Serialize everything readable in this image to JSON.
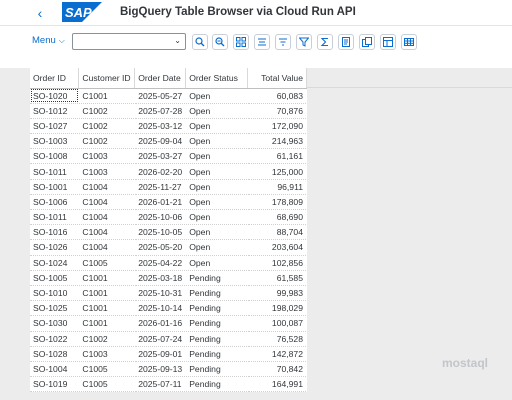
{
  "header": {
    "back_icon": "back-chevron-icon",
    "logo_text": "SAP",
    "logo_color": "#0a6ed1",
    "title": "BigQuery Table Browser via Cloud Run API"
  },
  "toolbar": {
    "menu_label": "Menu",
    "select_value": "",
    "buttons": [
      "zoom-icon",
      "find-icon",
      "hierarchy-icon",
      "align-icon",
      "sort-icon",
      "filter-icon",
      "sum-icon",
      "print-icon",
      "export-icon",
      "layout-icon",
      "grid-icon"
    ]
  },
  "table": {
    "columns": [
      "Order ID",
      "Customer ID",
      "Order Date",
      "Order Status",
      "Total Value"
    ],
    "rows": [
      [
        "SO-1020",
        "C1001",
        "2025-05-27",
        "Open",
        "60,083"
      ],
      [
        "SO-1012",
        "C1002",
        "2025-07-28",
        "Open",
        "70,876"
      ],
      [
        "SO-1027",
        "C1002",
        "2025-03-12",
        "Open",
        "172,090"
      ],
      [
        "SO-1003",
        "C1002",
        "2025-09-04",
        "Open",
        "214,963"
      ],
      [
        "SO-1008",
        "C1003",
        "2025-03-27",
        "Open",
        "61,161"
      ],
      [
        "SO-1011",
        "C1003",
        "2026-02-20",
        "Open",
        "125,000"
      ],
      [
        "SO-1001",
        "C1004",
        "2025-11-27",
        "Open",
        "96,911"
      ],
      [
        "SO-1006",
        "C1004",
        "2026-01-21",
        "Open",
        "178,809"
      ],
      [
        "SO-1011",
        "C1004",
        "2025-10-06",
        "Open",
        "68,690"
      ],
      [
        "SO-1016",
        "C1004",
        "2025-10-05",
        "Open",
        "88,704"
      ],
      [
        "SO-1026",
        "C1004",
        "2025-05-20",
        "Open",
        "203,604"
      ],
      [
        "SO-1024",
        "C1005",
        "2025-04-22",
        "Open",
        "102,856"
      ],
      [
        "SO-1005",
        "C1001",
        "2025-03-18",
        "Pending",
        "61,585"
      ],
      [
        "SO-1010",
        "C1001",
        "2025-10-31",
        "Pending",
        "99,983"
      ],
      [
        "SO-1025",
        "C1001",
        "2025-10-14",
        "Pending",
        "198,029"
      ],
      [
        "SO-1030",
        "C1001",
        "2026-01-16",
        "Pending",
        "100,087"
      ],
      [
        "SO-1022",
        "C1002",
        "2025-07-24",
        "Pending",
        "76,528"
      ],
      [
        "SO-1028",
        "C1003",
        "2025-09-01",
        "Pending",
        "142,872"
      ],
      [
        "SO-1004",
        "C1005",
        "2025-09-13",
        "Pending",
        "70,842"
      ],
      [
        "SO-1019",
        "C1005",
        "2025-07-11",
        "Pending",
        "164,991"
      ]
    ]
  },
  "watermark": "mostaql"
}
